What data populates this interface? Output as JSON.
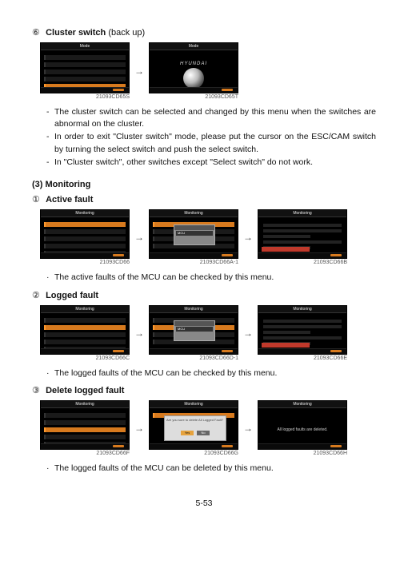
{
  "sections": {
    "cluster": {
      "num": "⑥",
      "title_bold": "Cluster switch",
      "title_rest": "(back up)",
      "fig1": {
        "caption": "21093CD65S",
        "title": "Mode"
      },
      "fig2": {
        "caption": "21093CD65T",
        "title": "Mode",
        "brand": "HYUNDAI"
      },
      "bullets": [
        "The cluster switch can be selected and changed by this menu when the switches are abnormal on the cluster.",
        "In order to exit \"Cluster switch\" mode, please put the cursor on the ESC/CAM switch by turning the select switch and push the select switch.",
        "In \"Cluster switch\", other switches except \"Select switch\" do not work."
      ]
    },
    "monitoring_heading": "(3) Monitoring",
    "active": {
      "num": "①",
      "title": "Active fault",
      "fig1": {
        "caption": "21093CD66",
        "title": "Monitoring",
        "hl_text": "Active Fault"
      },
      "fig2": {
        "caption": "21093CD66A-1",
        "title": "Monitoring",
        "popup_hl": "Active Fault",
        "popup_opt": "MCU"
      },
      "fig3": {
        "caption": "21093CD66B",
        "title": "Monitoring",
        "panel": "Active Fault"
      },
      "note": "The active faults of the MCU can be checked by this menu."
    },
    "logged": {
      "num": "②",
      "title": "Logged fault",
      "fig1": {
        "caption": "21093CD66C",
        "title": "Monitoring",
        "hl_text": "Logged Fault"
      },
      "fig2": {
        "caption": "21093CD66D-1",
        "title": "Monitoring",
        "popup_hl": "Logged Fault",
        "popup_opt": "MCU"
      },
      "fig3": {
        "caption": "21093CD66E",
        "title": "Monitoring",
        "panel": "Logged Fault"
      },
      "note": "The logged faults of the MCU can be checked by this menu."
    },
    "delete": {
      "num": "③",
      "title": "Delete logged fault",
      "fig1": {
        "caption": "21093CD66F",
        "title": "Monitoring",
        "hl_text": "Delete Logged Fault"
      },
      "fig2": {
        "caption": "21093CD66G",
        "title": "Monitoring",
        "panel": "Logged Fault",
        "confirm_msg": "Are you sure to delete All Logged Fault?",
        "yes": "Yes",
        "no": "No"
      },
      "fig3": {
        "caption": "21093CD66H",
        "title": "Monitoring",
        "panel": "Logged Fault",
        "center_msg": "All logged faults are deleted."
      },
      "note": "The logged faults of the MCU can be deleted by this menu."
    }
  },
  "page_number": "5-53",
  "arrow": "→"
}
